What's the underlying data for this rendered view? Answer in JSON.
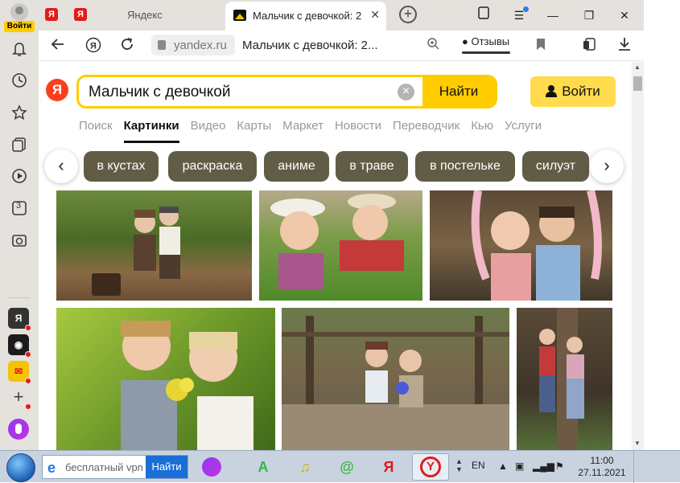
{
  "sidebar": {
    "login_badge": "Войти",
    "counter_badge": "3",
    "apps": [
      {
        "name": "yandex",
        "glyph": "Я",
        "color": "#333333"
      },
      {
        "name": "camera",
        "glyph": "◉",
        "color": "#1c1c1c"
      },
      {
        "name": "mail",
        "glyph": "✉",
        "color": "#f6c300"
      },
      {
        "name": "add",
        "glyph": "+",
        "color": "#e5e1dc"
      }
    ]
  },
  "tabs": {
    "pinned": [
      "Я",
      "Я"
    ],
    "inactive_title": "Яндекс",
    "active_title": "Мальчик с девочкой: 2",
    "close": "✕"
  },
  "window": {
    "minimize": "—",
    "maximize": "❐",
    "close": "✕"
  },
  "addressbar": {
    "domain": "yandex.ru",
    "page_title": "Мальчик с девочкой: 2...",
    "feedback": "Отзывы"
  },
  "search": {
    "logo": "Я",
    "query": "Мальчик с девочкой",
    "clear": "×",
    "submit": "Найти",
    "login": "Войти"
  },
  "services": [
    "Поиск",
    "Картинки",
    "Видео",
    "Карты",
    "Маркет",
    "Новости",
    "Переводчик",
    "Кью",
    "Услуги"
  ],
  "chips": {
    "prev": "‹",
    "next": "›",
    "items": [
      "в кустах",
      "раскраска",
      "аниме",
      "в траве",
      "в постельке",
      "силуэт"
    ]
  },
  "taskbar": {
    "search_text": "бесплатный vpn",
    "search_button": "Найти",
    "lang": "EN",
    "time": "11:00",
    "date": "27.11.2021",
    "apps": [
      {
        "name": "alice",
        "glyph": "◆",
        "color": "#7b3df0"
      },
      {
        "name": "yandex-maps",
        "glyph": "A",
        "color": "#2fb84f"
      },
      {
        "name": "yandex-music",
        "glyph": "♫",
        "color": "#f4c21b"
      },
      {
        "name": "mail-agent",
        "glyph": "@",
        "color": "#3fb547"
      },
      {
        "name": "yandex",
        "glyph": "Я",
        "color": "#e21b1b"
      },
      {
        "name": "yandex-browser",
        "glyph": "Y",
        "color": "#e21b1b"
      }
    ]
  },
  "colors": {
    "accent": "#ffcc00",
    "chip_bg": "#615c45",
    "brand_red": "#fc3f1d"
  }
}
